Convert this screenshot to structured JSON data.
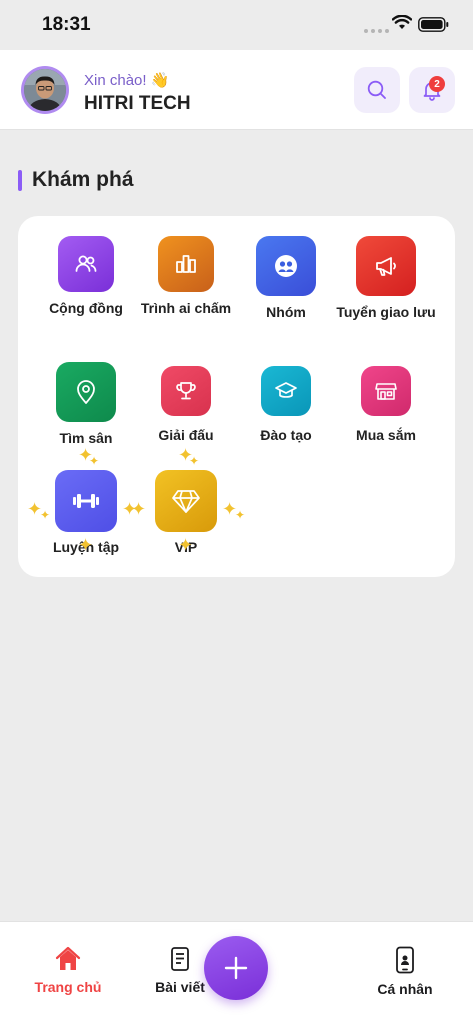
{
  "status_bar": {
    "time": "18:31"
  },
  "header": {
    "greeting": "Xin chào! 👋",
    "username": "HITRI TECH",
    "notification_count": "2"
  },
  "section": {
    "title": "Khám phá"
  },
  "tiles": [
    {
      "label": "Cộng đồng",
      "icon": "users-icon",
      "color": "#8b3fe0"
    },
    {
      "label": "Trình ai chấm",
      "icon": "bar-chart-icon",
      "color": "#d9701a"
    },
    {
      "label": "Nhóm",
      "icon": "group-icon",
      "color": "#3b5fe0"
    },
    {
      "label": "Tuyển giao lưu",
      "icon": "megaphone-icon",
      "color": "#e02a2a"
    },
    {
      "label": "Tìm sân",
      "icon": "location-pin-icon",
      "color": "#109a57"
    },
    {
      "label": "Giải đấu",
      "icon": "trophy-icon",
      "color": "#e63a5a"
    },
    {
      "label": "Đào tạo",
      "icon": "graduation-cap-icon",
      "color": "#0aa4c4"
    },
    {
      "label": "Mua sắm",
      "icon": "store-icon",
      "color": "#e0357a"
    },
    {
      "label": "Luyện tập",
      "icon": "dumbbell-icon",
      "color": "#5b5cf0"
    },
    {
      "label": "VIP",
      "icon": "diamond-icon",
      "color": "#e0ad10"
    }
  ],
  "bottom_nav": {
    "home": "Trang chủ",
    "posts": "Bài viết",
    "profile": "Cá nhân"
  }
}
